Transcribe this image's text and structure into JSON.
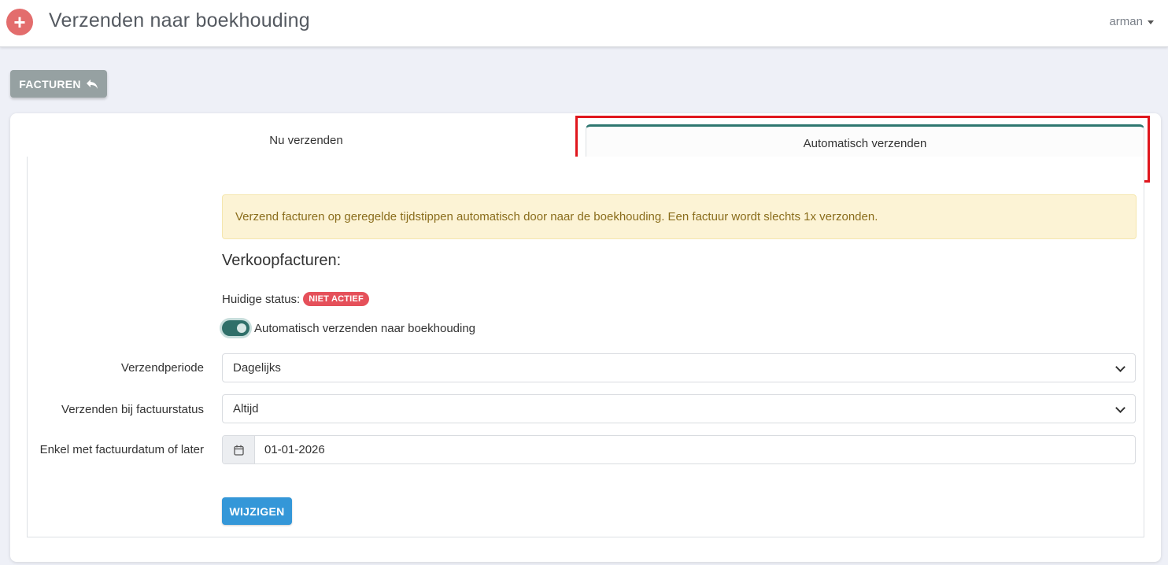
{
  "header": {
    "add_icon": "plus-icon",
    "add_symbol": "+",
    "title": "Verzenden naar boekhouding",
    "user": "arman"
  },
  "back_button": {
    "label": "FACTUREN",
    "icon": "reply-icon"
  },
  "tabs": [
    {
      "label": "Nu verzenden",
      "active": false
    },
    {
      "label": "Automatisch verzenden",
      "active": true
    }
  ],
  "alert": {
    "text": "Verzend facturen op geregelde tijdstippen automatisch door naar de boekhouding. Een factuur wordt slechts 1x verzonden."
  },
  "section": {
    "title": "Verkoopfacturen:",
    "status_label": "Huidige status:",
    "status_badge": "NIET ACTIEF",
    "toggle_label": "Automatisch verzenden naar boekhouding",
    "toggle_on": true
  },
  "form": {
    "period_label": "Verzendperiode",
    "period_value": "Dagelijks",
    "status_label": "Verzenden bij factuurstatus",
    "status_value": "Altijd",
    "date_label": "Enkel met factuurdatum of later",
    "date_icon": "calendar-icon",
    "date_value": "01-01-2026",
    "submit_label": "WIJZIGEN"
  },
  "colors": {
    "accent": "#2f7770",
    "danger": "#e5505a",
    "primary": "#3497d8",
    "highlight": "#e0161d"
  }
}
